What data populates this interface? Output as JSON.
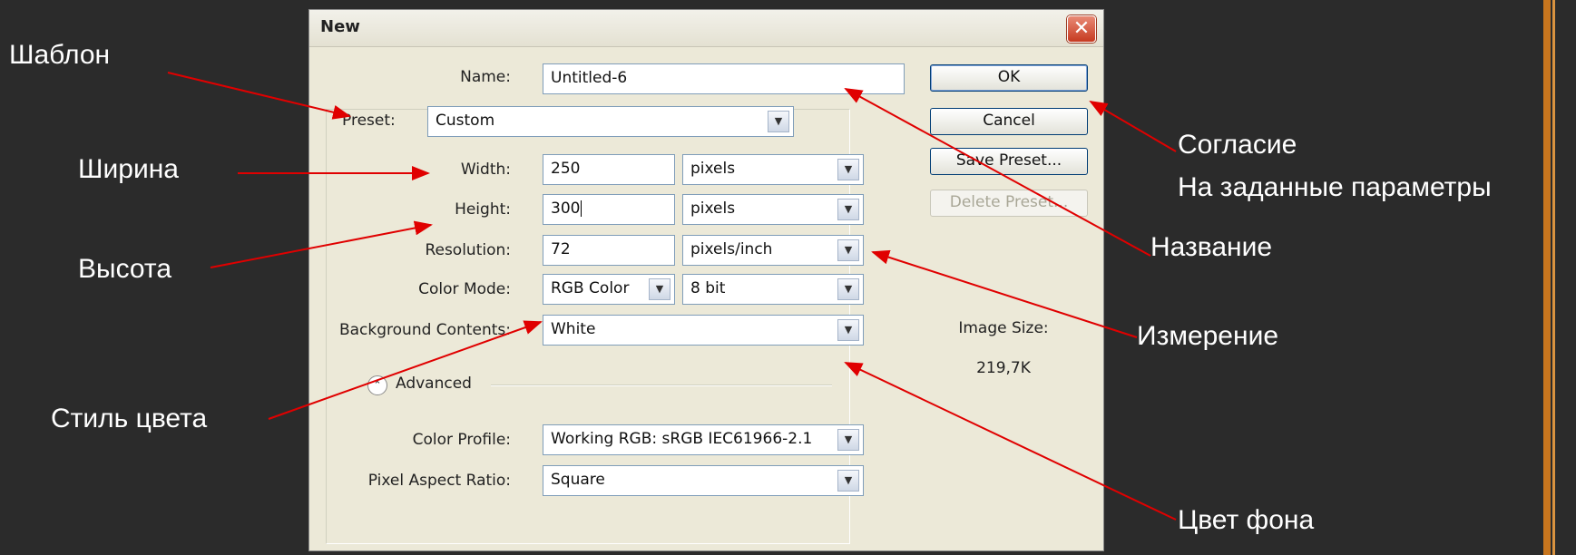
{
  "annotations": {
    "preset": "Шаблон",
    "width": "Ширина",
    "height": "Высота",
    "color_style": "Стиль цвета",
    "agree_line1": "Согласие",
    "agree_line2": "На заданные параметры",
    "name": "Название",
    "units": "Измерение",
    "background": "Цвет фона"
  },
  "dialog": {
    "title": "New",
    "close_icon": "close-icon",
    "name": {
      "label": "Name:",
      "value": "Untitled-6"
    },
    "preset": {
      "label": "Preset:",
      "value": "Custom"
    },
    "width": {
      "label": "Width:",
      "value": "250",
      "unit": "pixels"
    },
    "height": {
      "label": "Height:",
      "value": "300",
      "unit": "pixels"
    },
    "resolution": {
      "label": "Resolution:",
      "value": "72",
      "unit": "pixels/inch"
    },
    "color_mode": {
      "label": "Color Mode:",
      "value": "RGB Color",
      "depth": "8 bit"
    },
    "background_contents": {
      "label": "Background Contents:",
      "value": "White"
    },
    "advanced": {
      "label": "Advanced",
      "icon": "chevron-up-icon"
    },
    "color_profile": {
      "label": "Color Profile:",
      "value": "Working RGB:  sRGB IEC61966-2.1"
    },
    "pixel_aspect_ratio": {
      "label": "Pixel Aspect Ratio:",
      "value": "Square"
    },
    "buttons": {
      "ok": "OK",
      "cancel": "Cancel",
      "save_preset": "Save Preset...",
      "delete_preset": "Delete Preset..."
    },
    "image_size": {
      "label": "Image Size:",
      "value": "219,7K"
    }
  },
  "colors": {
    "background": "#2b2b2b",
    "arrow": "#e00000",
    "accent_bar": "#c8761e",
    "dialog": "#ece9d8"
  }
}
